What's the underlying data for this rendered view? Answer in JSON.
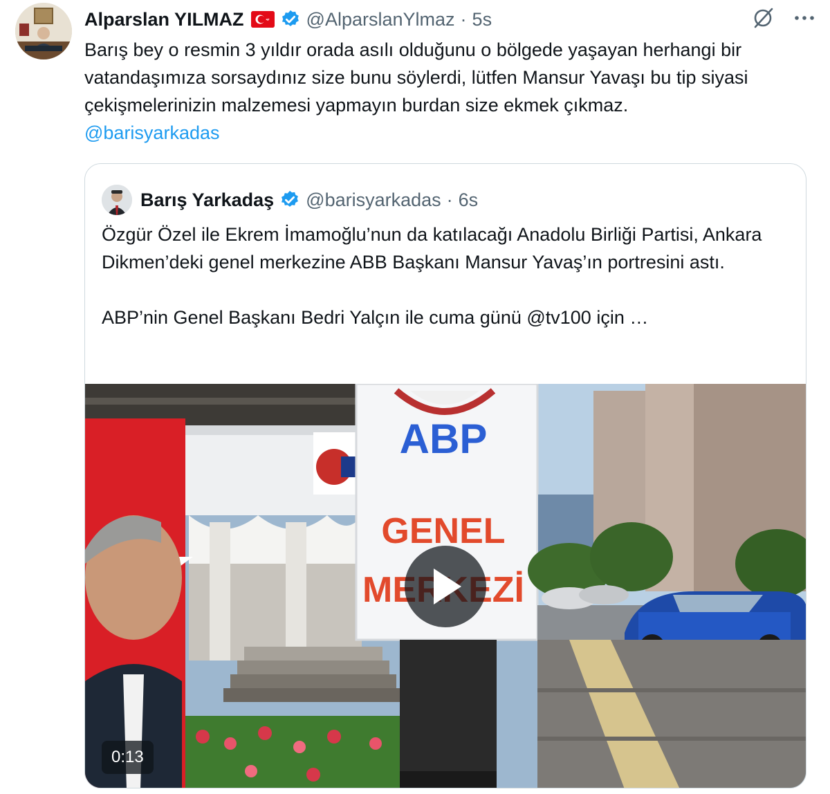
{
  "tweet": {
    "author_name": "Alparslan YILMAZ",
    "author_handle": "@AlparslanYlmaz",
    "separator": "·",
    "time": "5s",
    "flag_icon": "turkey-flag-icon",
    "text": "Barış bey o resmin 3 yıldır orada asılı olduğunu o bölgede yaşayan herhangi bir vatandaşımıza sorsaydınız size bunu söylerdi, lütfen Mansur Yavaşı bu tip siyasi çekişmelerinizin malzemesi yapmayın burdan size ekmek çıkmaz.",
    "mention": "@barisyarkadas"
  },
  "quoted": {
    "author_name": "Barış Yarkadaş",
    "author_handle": "@barisyarkadas",
    "separator": "·",
    "time": "6s",
    "text_p1": "Özgür Özel ile Ekrem İmamoğlu’nun da katılacağı Anadolu Birliği Partisi, Ankara Dikmen’deki genel merkezine ABB Başkanı Mansur Yavaş’ın portresini astı.",
    "text_p2": "ABP’nin Genel Başkanı Bedri Yalçın ile cuma günü @tv100 için …",
    "media": {
      "sign_top": "ABP",
      "sign_line1": "GENEL",
      "sign_line2": "MERKEZİ",
      "duration": "0:13"
    }
  },
  "colors": {
    "text": "#0f1419",
    "secondary": "#536471",
    "link": "#1d9bf0",
    "verified": "#1d9bf0",
    "border": "#cfd9de"
  }
}
